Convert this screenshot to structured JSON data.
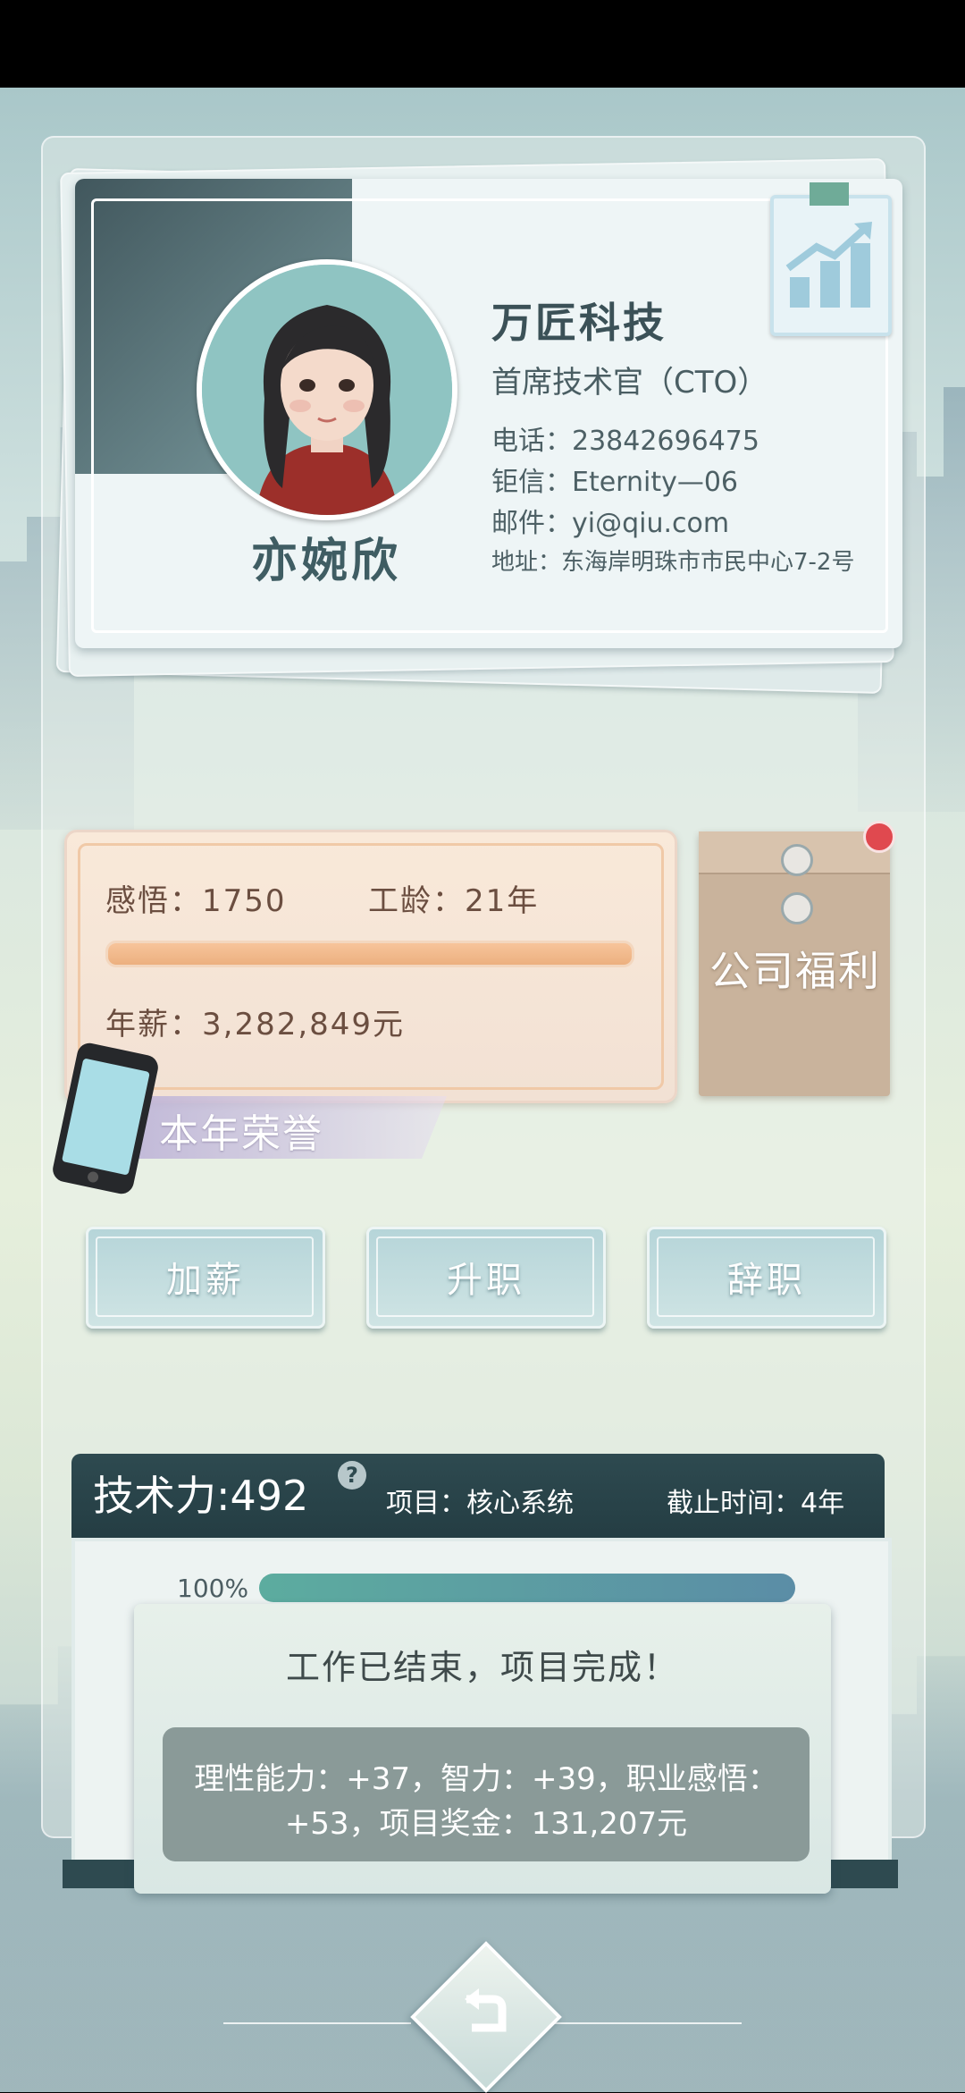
{
  "card": {
    "name": "亦婉欣",
    "company": "万匠科技",
    "job_title": "首席技术官（CTO）",
    "phone": "电话：23842696475",
    "messenger": "钜信：Eternity—06",
    "email": "邮件：yi@qiu.com",
    "address": "地址：东海岸明珠市市民中心7-2号"
  },
  "stats": {
    "insight": "感悟：1750",
    "seniority": "工龄：21年",
    "salary": "年薪：3,282,849元",
    "insight_progress": 1.0
  },
  "honor_label": "本年荣誉",
  "benefits_label": "公司福利",
  "actions": {
    "raise": "加薪",
    "promote": "升职",
    "resign": "辞职"
  },
  "project": {
    "tech_power": "技术力:492",
    "help": "?",
    "name": "项目：核心系统",
    "deadline": "截止时间：4年",
    "progress_text": "100%",
    "progress": 1.0
  },
  "dialog": {
    "title": "工作已结束，项目完成！",
    "reward_line1": "理性能力：+37，智力：+39，职业感悟：",
    "reward_line2": "+53，项目奖金：131,207元"
  },
  "colors": {
    "accent_dark": "#2e4a50",
    "progress_start": "#5cac9f",
    "progress_end": "#5b8da6",
    "notification": "#e0494f"
  }
}
